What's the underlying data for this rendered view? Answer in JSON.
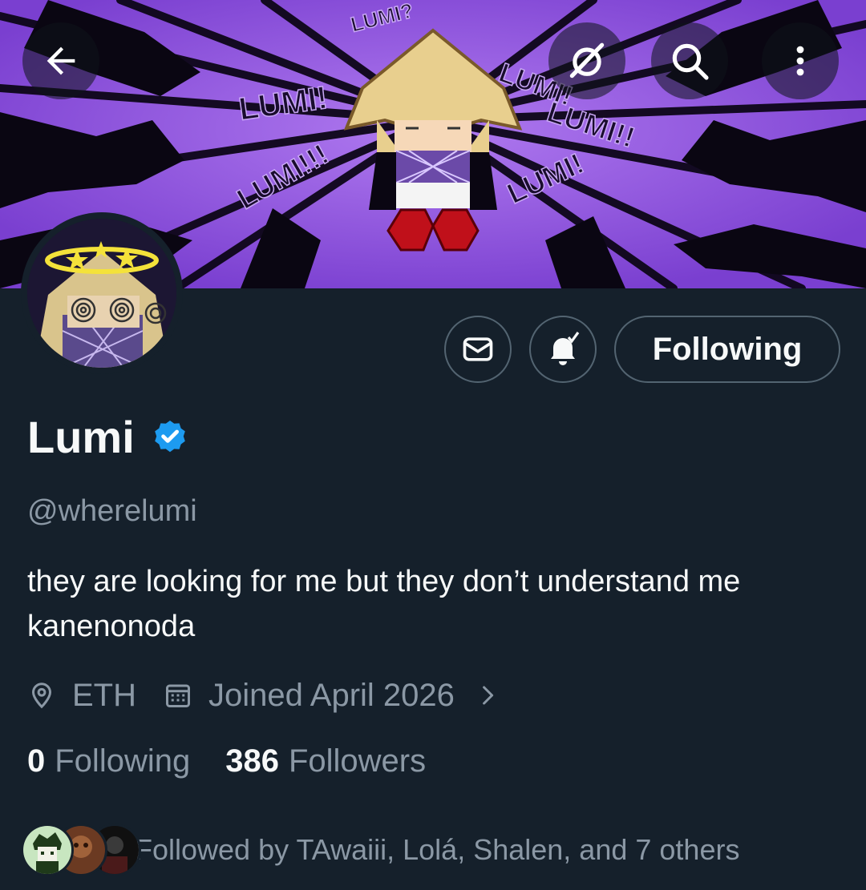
{
  "profile": {
    "display_name": "Lumi",
    "handle": "@wherelumi",
    "bio": "they are looking for me but they don’t understand me  kanenonoda",
    "location": "ETH",
    "joined": "Joined April 2026"
  },
  "actions": {
    "follow_state": "Following"
  },
  "stats": {
    "following_count": "0",
    "following_label": "Following",
    "followers_count": "386",
    "followers_label": "Followers"
  },
  "social_proof": {
    "text": "Followed by TAwaiii, Lolá, Shalen, and 7 others"
  },
  "banner_text": {
    "lumi_1": "LUMI!",
    "lumi_2": "LUMI!!!",
    "lumi_3": "LUMI!",
    "lumi_4": "LUMI!!",
    "lumi_5": "LUMI!",
    "lumi_6": "LUMI?"
  },
  "icons": {
    "back": "arrow-left-icon",
    "grok": "grok-icon",
    "search": "search-icon",
    "more": "more-vertical-icon",
    "message": "envelope-icon",
    "notifications": "bell-check-icon",
    "verified": "verified-badge-icon",
    "location": "location-pin-icon",
    "calendar": "calendar-icon",
    "chevron": "chevron-right-icon"
  },
  "colors": {
    "background": "#15202b",
    "text_primary": "#f7f9f9",
    "text_secondary": "#8b98a5",
    "border": "#536471",
    "verified_blue": "#1d9bf0",
    "banner_purple": "#8a4fd6"
  }
}
